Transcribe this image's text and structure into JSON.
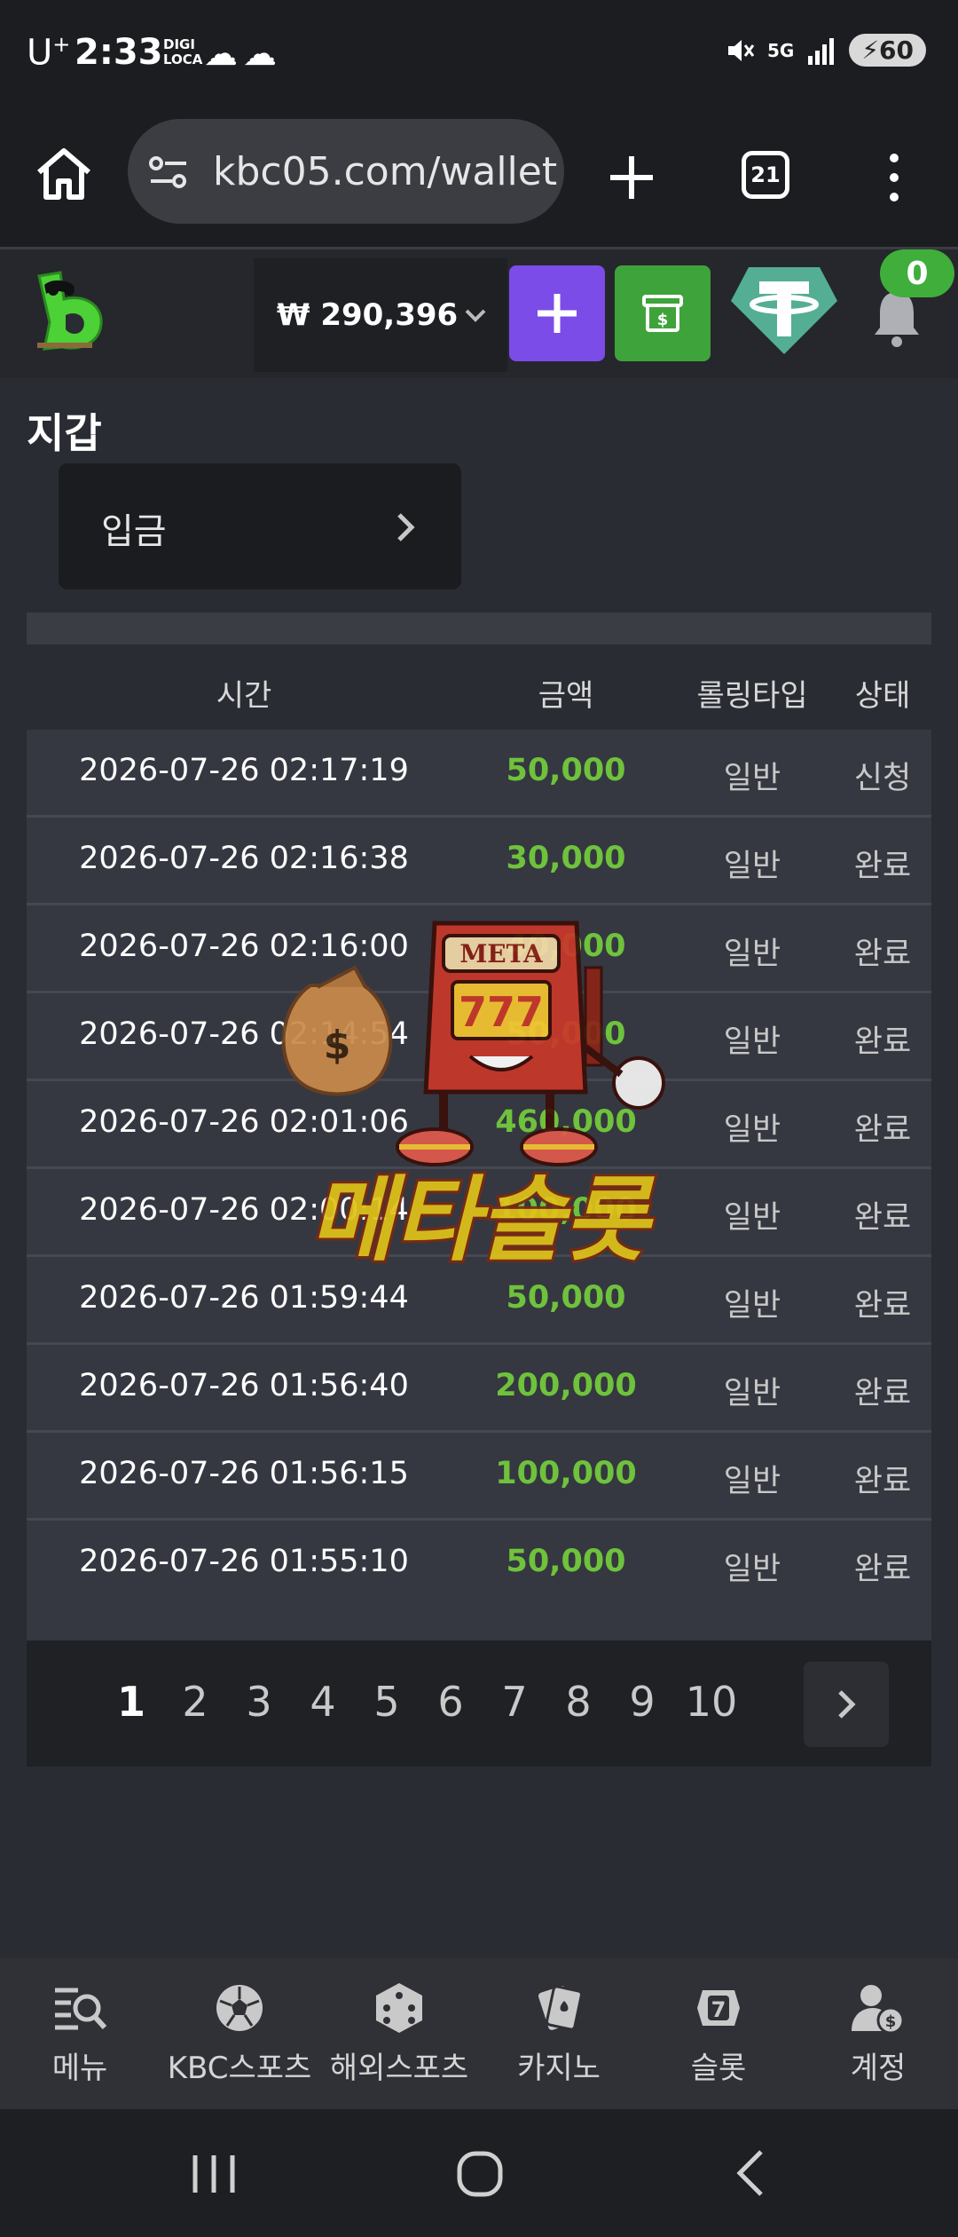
{
  "status_bar": {
    "carrier": "U",
    "carrier_sup": "+",
    "time": "2:33",
    "digi_line1": "DIGI",
    "digi_line2": "LOCA",
    "network": "5G",
    "battery": "60"
  },
  "browser": {
    "url": "kbc05.com/wallet",
    "tab_count": "21"
  },
  "header": {
    "balance": "₩ 290,396",
    "notification_count": "0"
  },
  "page": {
    "title": "지갑",
    "deposit_label": "입금"
  },
  "table": {
    "headers": [
      "시간",
      "금액",
      "롤링타입",
      "상태"
    ],
    "rows": [
      {
        "time": "2026-07-26 02:17:19",
        "amount": "50,000",
        "rolling": "일반",
        "status": "신청"
      },
      {
        "time": "2026-07-26 02:16:38",
        "amount": "30,000",
        "rolling": "일반",
        "status": "완료"
      },
      {
        "time": "2026-07-26 02:16:00",
        "amount": "40,000",
        "rolling": "일반",
        "status": "완료"
      },
      {
        "time": "2026-07-26 02:14:54",
        "amount": "50,000",
        "rolling": "일반",
        "status": "완료"
      },
      {
        "time": "2026-07-26 02:01:06",
        "amount": "460,000",
        "rolling": "일반",
        "status": "완료"
      },
      {
        "time": "2026-07-26 02:00:14",
        "amount": "100,000",
        "rolling": "일반",
        "status": "완료"
      },
      {
        "time": "2026-07-26 01:59:44",
        "amount": "50,000",
        "rolling": "일반",
        "status": "완료"
      },
      {
        "time": "2026-07-26 01:56:40",
        "amount": "200,000",
        "rolling": "일반",
        "status": "완료"
      },
      {
        "time": "2026-07-26 01:56:15",
        "amount": "100,000",
        "rolling": "일반",
        "status": "완료"
      },
      {
        "time": "2026-07-26 01:55:10",
        "amount": "50,000",
        "rolling": "일반",
        "status": "완료"
      }
    ]
  },
  "pagination": {
    "pages": [
      "1",
      "2",
      "3",
      "4",
      "5",
      "6",
      "7",
      "8",
      "9",
      "10"
    ],
    "current": "1"
  },
  "watermark": {
    "sign": "META",
    "reels": "777",
    "text": "메타슬롯"
  },
  "bottom_nav": [
    {
      "label": "메뉴",
      "icon": "menu-search-icon"
    },
    {
      "label": "KBC스포츠",
      "icon": "soccer-ball-icon"
    },
    {
      "label": "해외스포츠",
      "icon": "dice-icon"
    },
    {
      "label": "카지노",
      "icon": "playing-cards-icon"
    },
    {
      "label": "슬롯",
      "icon": "slot-seven-icon"
    },
    {
      "label": "계정",
      "icon": "user-coin-icon"
    }
  ],
  "colors": {
    "amount_green": "#6fc23c",
    "deposit_purple": "#7b4ce8",
    "cashier_green": "#3fa33b",
    "tether_teal": "#53ae94",
    "badge_green": "#3fae3b"
  }
}
